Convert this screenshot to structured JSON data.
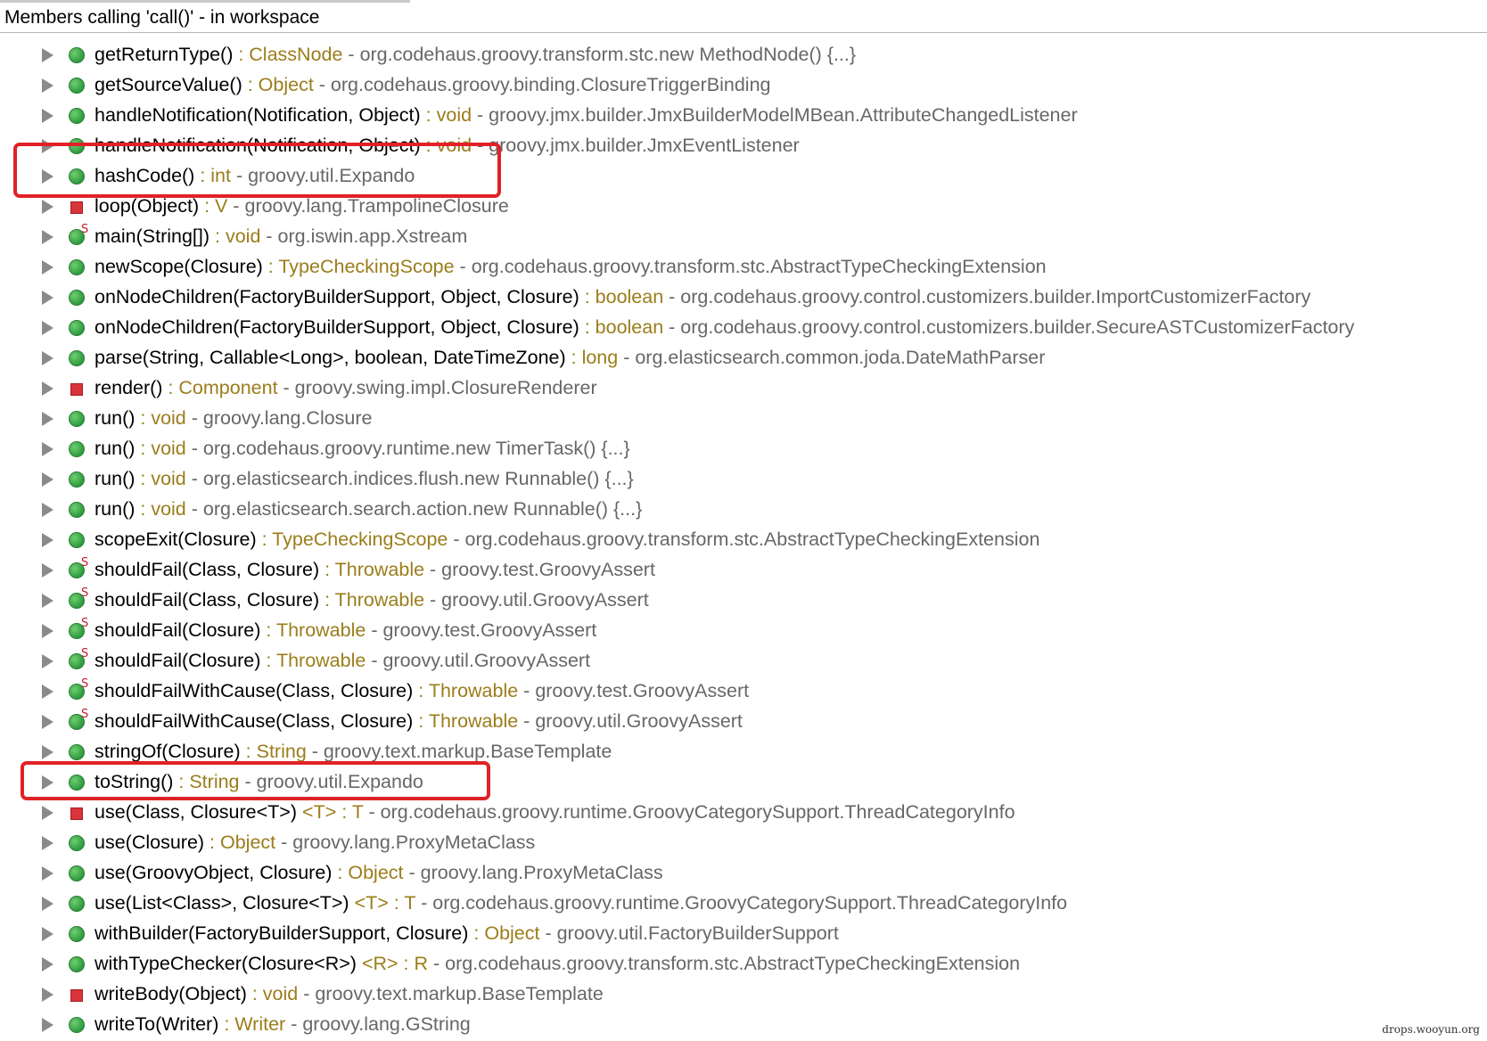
{
  "header": {
    "title": "Members calling 'call()' - in workspace"
  },
  "colors": {
    "accent_return_type": "#9b7d1b",
    "declaring_type": "#676767",
    "highlight": "#e02227"
  },
  "rows": [
    {
      "method": "getReturnType()",
      "typeparams": "",
      "rtype": "ClassNode",
      "decl": "org.codehaus.groovy.transform.stc.new MethodNode() {...}",
      "icon": "public-method-icon",
      "static": false
    },
    {
      "method": "getSourceValue()",
      "typeparams": "",
      "rtype": "Object",
      "decl": "org.codehaus.groovy.binding.ClosureTriggerBinding",
      "icon": "public-method-icon",
      "static": false
    },
    {
      "method": "handleNotification(Notification, Object)",
      "typeparams": "",
      "rtype": "void",
      "decl": "groovy.jmx.builder.JmxBuilderModelMBean.AttributeChangedListener",
      "icon": "public-method-icon",
      "static": false
    },
    {
      "method": "handleNotification(Notification, Object)",
      "typeparams": "",
      "rtype": "void",
      "decl": "groovy.jmx.builder.JmxEventListener",
      "icon": "public-method-icon",
      "static": false
    },
    {
      "method": "hashCode()",
      "typeparams": "",
      "rtype": "int",
      "decl": "groovy.util.Expando",
      "icon": "public-method-icon",
      "static": false
    },
    {
      "method": "loop(Object)",
      "typeparams": "",
      "rtype": "V",
      "decl": "groovy.lang.TrampolineClosure",
      "icon": "private-method-icon",
      "static": false
    },
    {
      "method": "main(String[])",
      "typeparams": "",
      "rtype": "void",
      "decl": "org.iswin.app.Xstream",
      "icon": "public-method-icon",
      "static": true
    },
    {
      "method": "newScope(Closure)",
      "typeparams": "",
      "rtype": "TypeCheckingScope",
      "decl": "org.codehaus.groovy.transform.stc.AbstractTypeCheckingExtension",
      "icon": "public-method-icon",
      "static": false
    },
    {
      "method": "onNodeChildren(FactoryBuilderSupport, Object, Closure)",
      "typeparams": "",
      "rtype": "boolean",
      "decl": "org.codehaus.groovy.control.customizers.builder.ImportCustomizerFactory",
      "icon": "public-method-icon",
      "static": false
    },
    {
      "method": "onNodeChildren(FactoryBuilderSupport, Object, Closure)",
      "typeparams": "",
      "rtype": "boolean",
      "decl": "org.codehaus.groovy.control.customizers.builder.SecureASTCustomizerFactory",
      "icon": "public-method-icon",
      "static": false
    },
    {
      "method": "parse(String, Callable<Long>, boolean, DateTimeZone)",
      "typeparams": "",
      "rtype": "long",
      "decl": "org.elasticsearch.common.joda.DateMathParser",
      "icon": "public-method-icon",
      "static": false
    },
    {
      "method": "render()",
      "typeparams": "",
      "rtype": "Component",
      "decl": "groovy.swing.impl.ClosureRenderer",
      "icon": "private-method-icon",
      "static": false
    },
    {
      "method": "run()",
      "typeparams": "",
      "rtype": "void",
      "decl": "groovy.lang.Closure",
      "icon": "public-method-icon",
      "static": false
    },
    {
      "method": "run()",
      "typeparams": "",
      "rtype": "void",
      "decl": "org.codehaus.groovy.runtime.new TimerTask() {...}",
      "icon": "public-method-icon",
      "static": false
    },
    {
      "method": "run()",
      "typeparams": "",
      "rtype": "void",
      "decl": "org.elasticsearch.indices.flush.new Runnable() {...}",
      "icon": "public-method-icon",
      "static": false
    },
    {
      "method": "run()",
      "typeparams": "",
      "rtype": "void",
      "decl": "org.elasticsearch.search.action.new Runnable() {...}",
      "icon": "public-method-icon",
      "static": false
    },
    {
      "method": "scopeExit(Closure)",
      "typeparams": "",
      "rtype": "TypeCheckingScope",
      "decl": "org.codehaus.groovy.transform.stc.AbstractTypeCheckingExtension",
      "icon": "public-method-icon",
      "static": false
    },
    {
      "method": "shouldFail(Class, Closure)",
      "typeparams": "",
      "rtype": "Throwable",
      "decl": "groovy.test.GroovyAssert",
      "icon": "public-method-icon",
      "static": true
    },
    {
      "method": "shouldFail(Class, Closure)",
      "typeparams": "",
      "rtype": "Throwable",
      "decl": "groovy.util.GroovyAssert",
      "icon": "public-method-icon",
      "static": true
    },
    {
      "method": "shouldFail(Closure)",
      "typeparams": "",
      "rtype": "Throwable",
      "decl": "groovy.test.GroovyAssert",
      "icon": "public-method-icon",
      "static": true
    },
    {
      "method": "shouldFail(Closure)",
      "typeparams": "",
      "rtype": "Throwable",
      "decl": "groovy.util.GroovyAssert",
      "icon": "public-method-icon",
      "static": true
    },
    {
      "method": "shouldFailWithCause(Class, Closure)",
      "typeparams": "",
      "rtype": "Throwable",
      "decl": "groovy.test.GroovyAssert",
      "icon": "public-method-icon",
      "static": true
    },
    {
      "method": "shouldFailWithCause(Class, Closure)",
      "typeparams": "",
      "rtype": "Throwable",
      "decl": "groovy.util.GroovyAssert",
      "icon": "public-method-icon",
      "static": true
    },
    {
      "method": "stringOf(Closure)",
      "typeparams": "",
      "rtype": "String",
      "decl": "groovy.text.markup.BaseTemplate",
      "icon": "public-method-icon",
      "static": false
    },
    {
      "method": "toString()",
      "typeparams": "",
      "rtype": "String",
      "decl": "groovy.util.Expando",
      "icon": "public-method-icon",
      "static": false
    },
    {
      "method": "use(Class, Closure<T>)",
      "typeparams": "<T>",
      "rtype": "T",
      "decl": "org.codehaus.groovy.runtime.GroovyCategorySupport.ThreadCategoryInfo",
      "icon": "private-method-icon",
      "static": false
    },
    {
      "method": "use(Closure)",
      "typeparams": "",
      "rtype": "Object",
      "decl": "groovy.lang.ProxyMetaClass",
      "icon": "public-method-icon",
      "static": false
    },
    {
      "method": "use(GroovyObject, Closure)",
      "typeparams": "",
      "rtype": "Object",
      "decl": "groovy.lang.ProxyMetaClass",
      "icon": "public-method-icon",
      "static": false
    },
    {
      "method": "use(List<Class>, Closure<T>)",
      "typeparams": "<T>",
      "rtype": "T",
      "decl": "org.codehaus.groovy.runtime.GroovyCategorySupport.ThreadCategoryInfo",
      "icon": "public-method-icon",
      "static": false
    },
    {
      "method": "withBuilder(FactoryBuilderSupport, Closure)",
      "typeparams": "",
      "rtype": "Object",
      "decl": "groovy.util.FactoryBuilderSupport",
      "icon": "public-method-icon",
      "static": false
    },
    {
      "method": "withTypeChecker(Closure<R>)",
      "typeparams": "<R>",
      "rtype": "R",
      "decl": "org.codehaus.groovy.transform.stc.AbstractTypeCheckingExtension",
      "icon": "public-method-icon",
      "static": false
    },
    {
      "method": "writeBody(Object)",
      "typeparams": "",
      "rtype": "void",
      "decl": "groovy.text.markup.BaseTemplate",
      "icon": "private-method-icon",
      "static": false
    },
    {
      "method": "writeTo(Writer)",
      "typeparams": "",
      "rtype": "Writer",
      "decl": "groovy.lang.GString",
      "icon": "public-method-icon",
      "static": false
    }
  ],
  "highlighted_rows": [
    4,
    24
  ],
  "watermark": "drops.wooyun.org"
}
